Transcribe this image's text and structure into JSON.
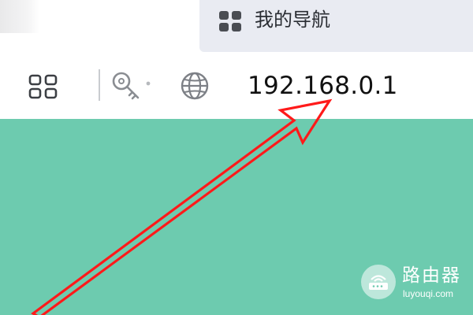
{
  "tab": {
    "label": "我的导航",
    "icon": "grid-icon"
  },
  "toolbar": {
    "apps_icon": "apps-grid-icon",
    "key_icon": "key-icon",
    "globe_icon": "globe-icon",
    "address": "192.168.0.1"
  },
  "annotation": {
    "arrow_color": "#ff1a1a",
    "points_to": "address-bar"
  },
  "page": {
    "background": "#6dcbaf"
  },
  "watermark": {
    "title": "路由器",
    "subtitle": "luyouqi.com",
    "icon": "router-icon"
  }
}
